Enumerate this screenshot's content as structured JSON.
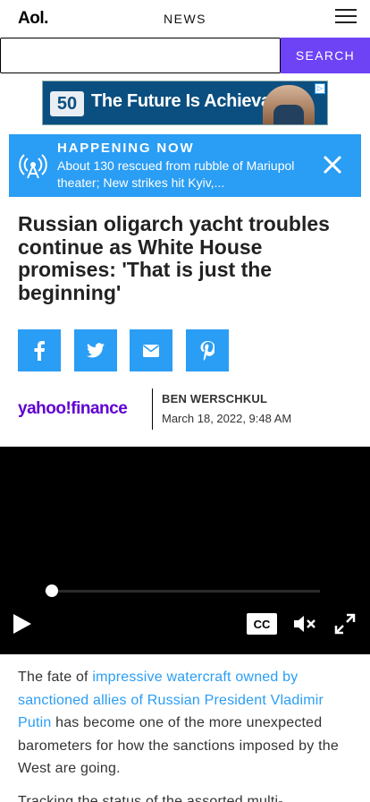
{
  "header": {
    "logo": "Aol.",
    "section": "NEWS"
  },
  "search": {
    "value": "",
    "placeholder": "",
    "button_label": "SEARCH"
  },
  "ad": {
    "logo_text": "50",
    "text": "The Future Is Achievable"
  },
  "banner": {
    "heading": "HAPPENING NOW",
    "text": "About 130 rescued from rubble of Mariupol theater; New strikes hit Kyiv,..."
  },
  "article": {
    "headline": "Russian oligarch yacht troubles continue as White House promises: 'That is just the beginning'",
    "source_logo": "yahoo!finance",
    "author": "BEN WERSCHKUL",
    "date": "March 18, 2022, 9:48 AM",
    "para1_prefix": "The fate of ",
    "para1_link": "impressive watercraft owned by sanctioned allies of Russian President Vladimir Putin",
    "para1_suffix": " has become one of the more unexpected barometers for how the sanctions imposed by the West are going.",
    "para2": "Tracking the status of the assorted multi-..."
  },
  "share": {
    "facebook": "facebook-icon",
    "twitter": "twitter-icon",
    "email": "email-icon",
    "pinterest": "pinterest-icon"
  },
  "video": {
    "progress": 0.0,
    "cc_label": "CC"
  },
  "colors": {
    "accent": "#2a9df4",
    "search_button": "#6e42f5",
    "yahoo_purple": "#6001d2"
  }
}
